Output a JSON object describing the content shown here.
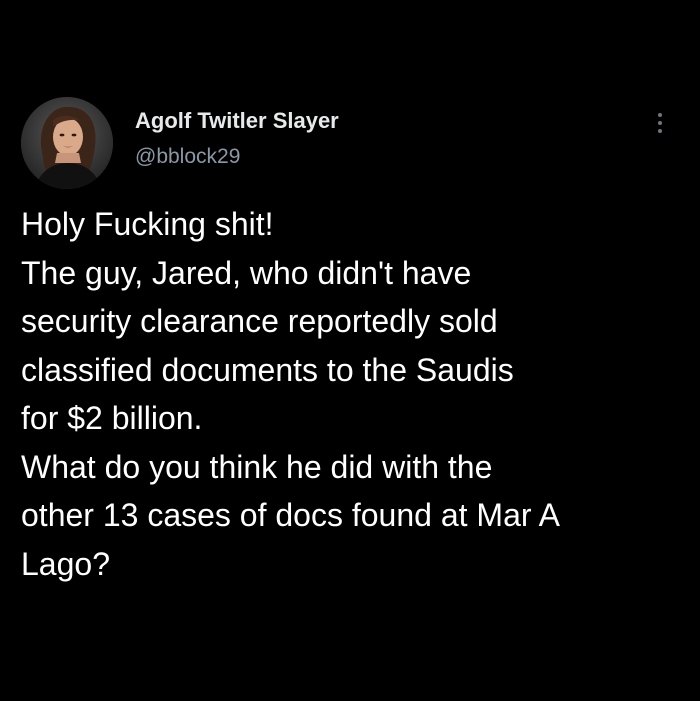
{
  "author": {
    "display_name": "Agolf Twitler Slayer",
    "handle": "@bblock29",
    "avatar_icon": "profile-photo"
  },
  "menu": {
    "icon": "more-vertical-icon"
  },
  "tweet": {
    "lines": [
      "Holy Fucking shit!",
      "The guy, Jared, who didn't have",
      "security clearance reportedly sold",
      "classified documents to the Saudis",
      "for $2 billion.",
      "What do you think he did with the",
      "other 13 cases of docs found at Mar A",
      "Lago?"
    ]
  },
  "colors": {
    "background": "#000000",
    "text": "#ffffff",
    "secondary_text": "#8b98a5"
  }
}
